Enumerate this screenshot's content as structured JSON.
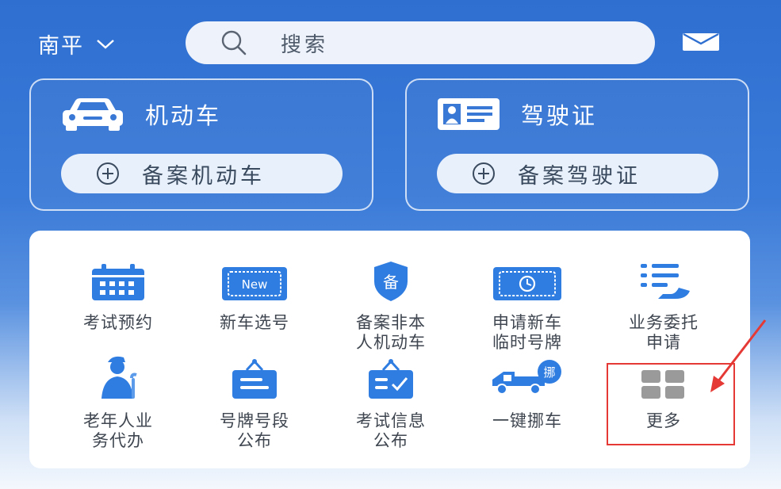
{
  "header": {
    "city": "南平",
    "search_placeholder": "搜索"
  },
  "cards": [
    {
      "title": "机动车",
      "button": "备案机动车",
      "icon": "car-icon"
    },
    {
      "title": "驾驶证",
      "button": "备案驾驶证",
      "icon": "license-card-icon"
    }
  ],
  "services": [
    {
      "label": "考试预约",
      "icon": "calendar-icon"
    },
    {
      "label": "新车选号",
      "icon": "new-plate-icon"
    },
    {
      "label": "备案非本人机动车",
      "icon": "shield-bei-icon"
    },
    {
      "label": "申请新车临时号牌",
      "icon": "temp-plate-icon"
    },
    {
      "label": "业务委托申请",
      "icon": "list-hand-icon"
    },
    {
      "label": "老年人业务代办",
      "icon": "elderly-icon"
    },
    {
      "label": "号牌号段公布",
      "icon": "plate-sign-icon"
    },
    {
      "label": "考试信息公布",
      "icon": "exam-sign-icon"
    },
    {
      "label": "一键挪车",
      "icon": "tow-truck-icon",
      "badge": "挪"
    },
    {
      "label": "更多",
      "icon": "more-grid-icon"
    }
  ],
  "colors": {
    "primary": "#2f6fd0",
    "icon_blue": "#2f7de1",
    "highlight": "#e53935"
  }
}
